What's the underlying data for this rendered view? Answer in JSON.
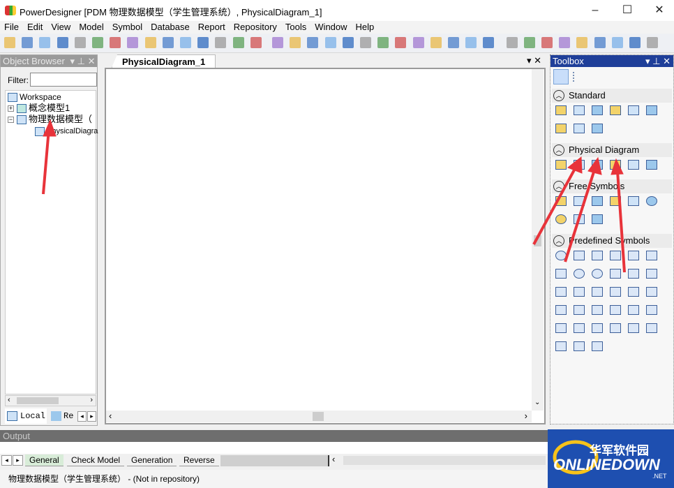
{
  "window": {
    "title": "PowerDesigner [PDM 物理数据模型（学生管理系统）, PhysicalDiagram_1]",
    "minimize": "–",
    "maximize": "☐",
    "close": "✕"
  },
  "menu": [
    "File",
    "Edit",
    "View",
    "Model",
    "Symbol",
    "Database",
    "Report",
    "Repository",
    "Tools",
    "Window",
    "Help"
  ],
  "toolbar_icons": [
    "new",
    "open-model",
    "open",
    "save",
    "save-all",
    "print-preview",
    "print",
    "cut",
    "copy",
    "paste",
    "delete",
    "undo",
    "redo",
    "properties",
    "check",
    "new-package",
    "paste-as",
    "impact",
    "refresh",
    "check-model",
    "rectangle",
    "grid",
    "pen",
    "fill",
    "font-color",
    "import",
    "back",
    "forward",
    "model-explorer",
    "diagram",
    "page",
    "list",
    "generate",
    "toolbox",
    "browser",
    "output",
    "result-list"
  ],
  "object_browser": {
    "title": "Object Browser",
    "pin": "▾ ⊥ ✕",
    "filter_label": "Filter:",
    "filter_value": "",
    "tree": [
      {
        "label": "Workspace"
      },
      {
        "label": "概念模型1"
      },
      {
        "label": "物理数据模型（"
      },
      {
        "label": "PhysicalDiagra"
      }
    ],
    "tabs": [
      "Local",
      "Re"
    ]
  },
  "document": {
    "tab": "PhysicalDiagram_1",
    "controls": "▾ ✕"
  },
  "toolbox": {
    "title": "Toolbox",
    "controls": "▾ ⊥ ✕",
    "sections": [
      {
        "label": "Standard",
        "icons": [
          "pointer",
          "grabber",
          "zoom-in",
          "zoom-out",
          "open-view",
          "properties",
          "delete",
          "link-note",
          "link"
        ]
      },
      {
        "label": "Physical Diagram",
        "icons": [
          "package",
          "table",
          "view",
          "reference",
          "procedure",
          "file"
        ]
      },
      {
        "label": "Free Symbols",
        "icons": [
          "note",
          "title",
          "line",
          "arc",
          "rectangle",
          "ellipse",
          "rounded-rectangle",
          "polyline",
          "polygon"
        ]
      },
      {
        "label": "Predefined Symbols",
        "icons": [
          "rounded-rect",
          "triangle",
          "right-triangle",
          "parallelogram",
          "trapezoid",
          "diamond",
          "pentagon",
          "hexagon",
          "circle",
          "star",
          "star6",
          "tab",
          "box",
          "shield",
          "frame",
          "frame2",
          "folder",
          "page",
          "callout",
          "cube",
          "box3",
          "stack",
          "cylinder",
          "actor",
          "actor2",
          "boxes",
          "arrow",
          "interface",
          "bulb",
          "cycle",
          "envelope",
          "screen",
          "panel"
        ]
      }
    ]
  },
  "output": {
    "title": "Output",
    "tabs": [
      "General",
      "Check Model",
      "Generation",
      "Reverse"
    ]
  },
  "status": "物理数据模型（学生管理系统） - (Not in repository)",
  "watermark": "华军软件园 ONLINEDOWN.NET",
  "colors": {
    "toolbox_header": "#1f3f99",
    "annotation_arrow": "#e8333a"
  }
}
